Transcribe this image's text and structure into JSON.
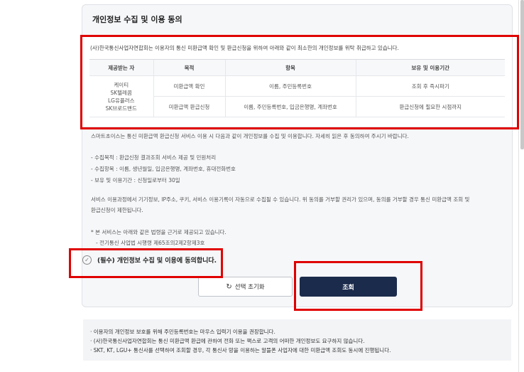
{
  "section_title": "개인정보 수집 및 이용 동의",
  "intro": "(사)한국통신사업자연합회는 이용자의 통신 미환급액 확인 및 환급신청을 위하여 아래와 같이 최소한의 개인정보를 위탁 취급하고 있습니다.",
  "table": {
    "headers": [
      "제공받는 자",
      "목적",
      "항목",
      "보유 및 이용기간"
    ],
    "providers": [
      "케이티",
      "SK텔레콤",
      "LG유플러스",
      "SK브로드밴드"
    ],
    "rows": [
      {
        "purpose": "미환급액 확인",
        "items": "이름, 주민등록번호",
        "period": "조회 후 즉시파기"
      },
      {
        "purpose": "미환급액 환급신청",
        "items": "이름, 주민등록번호, 입금은행명, 계좌번호",
        "period": "환급신청에 필요한 시점까지"
      }
    ]
  },
  "description": {
    "lead": "스마트초이스는 통신 미환급액 환급신청 서비스 이용 시 다음과 같이 개인정보를 수집 및 이용합니다. 자세히 읽은 후 동의하여 주시기 바랍니다.",
    "bullets": [
      "- 수집목적 : 환급신청 결과조회 서비스 제공 및 민원처리",
      "- 수집항목 : 이름, 생년월일, 입금은행명, 계좌번호, 휴대전화번호",
      "- 보유 및 이용기간 : 신청일로부터 30일"
    ],
    "auto_collect": [
      "서비스 이용과정에서 기기정보, IP주소, 쿠키, 서비스 이용기록이 자동으로 수집될 수 있습니다. 위 동의를 거부할 권리가 있으며, 동의를 거부할 경우 통신 미환급액 조회 및",
      "환급신청이 제한됩니다."
    ],
    "law_note": "* 본 서비스는 아래와 같은 법령을 근거로 제공되고 있습니다.",
    "law_item": "- 전기통신 사업법 시행령 제65조의2제2항제3호"
  },
  "consent": {
    "label": "(필수) 개인정보 수집 및 이용에 동의합니다.",
    "icon": "check-circle-icon"
  },
  "buttons": {
    "reset_label": "선택 초기화",
    "reset_icon": "↻",
    "search_label": "조회"
  },
  "notice": [
    "· 이용자의 개인정보 보호를 위해 주민등록번호는 마우스 입력기 이용을 권장합니다.",
    "· (사)한국통신사업자연합회는 통신 미환급액 환급에 관하여 전화 또는 팩스로 고객의 어떠한 개인정보도 요구하지 않습니다.",
    "· SKT, KT, LGU+ 통신사를 선택하여 조회할 경우, 각 통신사 망을 이용하는 알뜰폰 사업자에 대한 미환급액 조회도 동시에 진행됩니다."
  ],
  "colors": {
    "highlight": "#e00000",
    "primary_button": "#1b2b4b",
    "panel_bg": "#f6f7f9"
  }
}
